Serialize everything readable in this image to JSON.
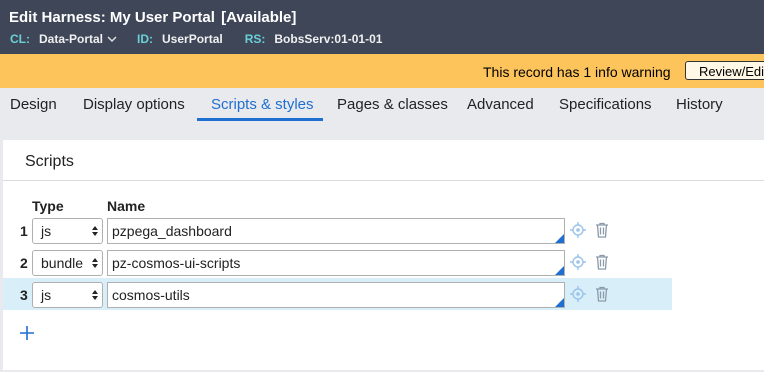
{
  "header": {
    "edit": "Edit",
    "title": "Harness: My User Portal",
    "status": "[Available]",
    "cl_label": "CL:",
    "cl_value": "Data-Portal",
    "id_label": "ID:",
    "id_value": "UserPortal",
    "rs_label": "RS:",
    "rs_value": "BobsServ:01-01-01"
  },
  "warning": {
    "text": "This record has 1 info warning",
    "button": "Review/Edit"
  },
  "tabs": [
    {
      "label": "Design"
    },
    {
      "label": "Display options"
    },
    {
      "label": "Scripts & styles"
    },
    {
      "label": "Pages & classes"
    },
    {
      "label": "Advanced"
    },
    {
      "label": "Specifications"
    },
    {
      "label": "History"
    }
  ],
  "active_tab": "Scripts & styles",
  "scripts": {
    "title": "Scripts",
    "col_type": "Type",
    "col_name": "Name",
    "rows": [
      {
        "num": "1",
        "type": "js",
        "name": "pzpega_dashboard"
      },
      {
        "num": "2",
        "type": "bundle",
        "name": "pz-cosmos-ui-scripts"
      },
      {
        "num": "3",
        "type": "js",
        "name": "cosmos-utils"
      }
    ]
  },
  "colors": {
    "header_bg": "#3f4658",
    "warning_bg": "#fdc45c",
    "accent": "#1f6fd1",
    "row_highlight": "#d8eef8"
  }
}
